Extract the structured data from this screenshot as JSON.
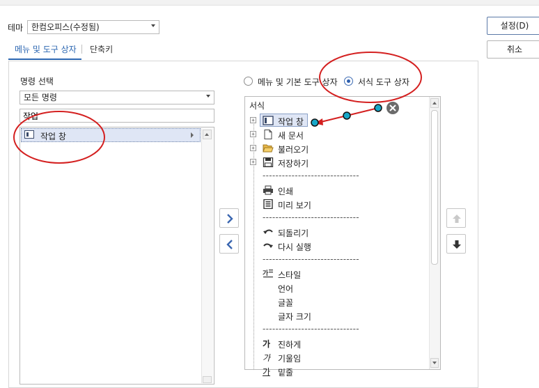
{
  "window": {
    "title": ""
  },
  "theme": {
    "label": "테마",
    "value": "한컴오피스(수정됨)"
  },
  "buttons": {
    "set": "설정(D)",
    "cancel": "취소"
  },
  "tabs": [
    {
      "label": "메뉴 및 도구 상자",
      "active": true
    },
    {
      "label": "단축키",
      "active": false
    }
  ],
  "left": {
    "command_label": "명령 선택",
    "filter_value": "모든 명령",
    "search_value": "작업",
    "items": [
      {
        "label": "작업 창",
        "icon": "task-pane-icon"
      }
    ]
  },
  "radios": [
    {
      "label": "메뉴 및 기본 도구 상자",
      "checked": false
    },
    {
      "label": "서식 도구 상자",
      "checked": true
    }
  ],
  "toolbar_tree": {
    "header": "서식",
    "separator": "------------------------------",
    "rows": [
      {
        "type": "item",
        "label": "작업 창",
        "icon": "task-pane-icon",
        "expand": true,
        "selected": true
      },
      {
        "type": "item",
        "label": "새 문서",
        "icon": "new-document-icon",
        "expand": true
      },
      {
        "type": "item",
        "label": "불러오기",
        "icon": "folder-open-icon",
        "expand": true
      },
      {
        "type": "item",
        "label": "저장하기",
        "icon": "save-icon",
        "expand": true
      },
      {
        "type": "separator"
      },
      {
        "type": "item",
        "label": "인쇄",
        "icon": "printer-icon"
      },
      {
        "type": "item",
        "label": "미리 보기",
        "icon": "preview-icon"
      },
      {
        "type": "separator"
      },
      {
        "type": "item",
        "label": "되돌리기",
        "icon": "undo-icon"
      },
      {
        "type": "item",
        "label": "다시 실행",
        "icon": "redo-icon"
      },
      {
        "type": "separator"
      },
      {
        "type": "item",
        "label": "스타일",
        "icon": "style-icon"
      },
      {
        "type": "item",
        "label": "언어",
        "icon": ""
      },
      {
        "type": "item",
        "label": "글꼴",
        "icon": ""
      },
      {
        "type": "item",
        "label": "글자 크기",
        "icon": ""
      },
      {
        "type": "separator"
      },
      {
        "type": "item",
        "label": "진하게",
        "icon": "bold-icon",
        "glyph": "가"
      },
      {
        "type": "item",
        "label": "기울임",
        "icon": "italic-icon",
        "glyph": "가"
      },
      {
        "type": "item",
        "label": "밑줄",
        "icon": "underline-icon",
        "glyph": "가"
      }
    ]
  },
  "colors": {
    "accent": "#2b66b1",
    "selection": "#dfe6f5",
    "annotation_red": "#d42020",
    "annotation_node": "#17a7c8"
  }
}
